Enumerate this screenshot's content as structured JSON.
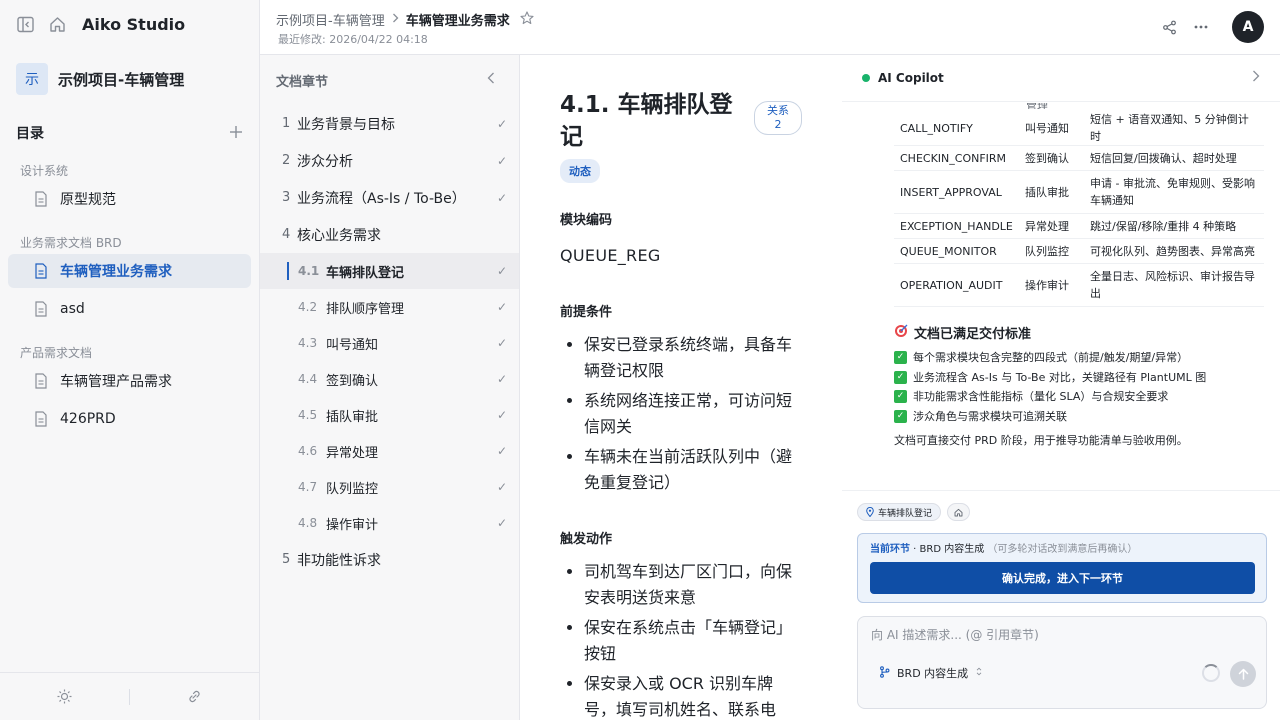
{
  "app": {
    "name": "Aiko Studio",
    "user_initial": "A"
  },
  "project": {
    "badge": "示",
    "name": "示例项目-车辆管理"
  },
  "sidebar": {
    "toc_label": "目录",
    "groups": [
      {
        "label": "设计系统",
        "items": [
          "原型规范"
        ]
      },
      {
        "label": "业务需求文档 BRD",
        "items": [
          "车辆管理业务需求",
          "asd"
        ]
      },
      {
        "label": "产品需求文档",
        "items": [
          "车辆管理产品需求",
          "426PRD"
        ]
      }
    ]
  },
  "topbar": {
    "crumb_project": "示例项目-车辆管理",
    "crumb_doc": "车辆管理业务需求",
    "modified": "最近修改: 2026/04/22 04:18"
  },
  "chapters": {
    "title": "文档章节",
    "items": [
      {
        "num": "1",
        "label": "业务背景与目标"
      },
      {
        "num": "2",
        "label": "涉众分析"
      },
      {
        "num": "3",
        "label": "业务流程（As-Is / To-Be）"
      },
      {
        "num": "4",
        "label": "核心业务需求"
      },
      {
        "num": "4.1",
        "label": "车辆排队登记"
      },
      {
        "num": "4.2",
        "label": "排队顺序管理"
      },
      {
        "num": "4.3",
        "label": "叫号通知"
      },
      {
        "num": "4.4",
        "label": "签到确认"
      },
      {
        "num": "4.5",
        "label": "插队审批"
      },
      {
        "num": "4.6",
        "label": "异常处理"
      },
      {
        "num": "4.7",
        "label": "队列监控"
      },
      {
        "num": "4.8",
        "label": "操作审计"
      },
      {
        "num": "5",
        "label": "非功能性诉求"
      }
    ]
  },
  "content": {
    "title": "4.1. 车辆排队登记",
    "relation_label": "关系",
    "relation_count": "2",
    "tag": "动态",
    "code_heading": "模块编码",
    "code": "QUEUE_REG",
    "pre_heading": "前提条件",
    "pre": [
      "保安已登录系统终端，具备车辆登记权限",
      "系统网络连接正常，可访问短信网关",
      "车辆未在当前活跃队列中（避免重复登记）"
    ],
    "trigger_heading": "触发动作",
    "trigger": [
      "司机驾车到达厂区门口，向保安表明送货来意",
      "保安在系统点击「车辆登记」按钮",
      "保安录入或 OCR 识别车牌号，填写司机姓名、联系电"
    ]
  },
  "copilot": {
    "title": "AI Copilot",
    "cut_text": "管理",
    "modules": [
      {
        "code": "CALL_NOTIFY",
        "name": "叫号通知",
        "desc": "短信 + 语音双通知、5 分钟倒计时"
      },
      {
        "code": "CHECKIN_CONFIRM",
        "name": "签到确认",
        "desc": "短信回复/回拨确认、超时处理"
      },
      {
        "code": "INSERT_APPROVAL",
        "name": "插队审批",
        "desc": "申请 - 审批流、免审规则、受影响车辆通知"
      },
      {
        "code": "EXCEPTION_HANDLE",
        "name": "异常处理",
        "desc": "跳过/保留/移除/重排 4 种策略"
      },
      {
        "code": "QUEUE_MONITOR",
        "name": "队列监控",
        "desc": "可视化队列、趋势图表、异常高亮"
      },
      {
        "code": "OPERATION_AUDIT",
        "name": "操作审计",
        "desc": "全量日志、风险标识、审计报告导出"
      }
    ],
    "std_title": "文档已满足交付标准",
    "checks": [
      "每个需求模块包含完整的四段式（前提/触发/期望/异常）",
      "业务流程含 As-Is 与 To-Be 对比，关键路径有 PlantUML 图",
      "非功能需求含性能指标（量化 SLA）与合规安全要求",
      "涉众角色与需求模块可追溯关联"
    ],
    "note": "文档可直接交付 PRD 阶段，用于推导功能清单与验收用例。",
    "context_chip": "车辆排队登记",
    "stage_lead": "当前环节",
    "stage_sep": " · ",
    "stage_name": "BRD 内容生成",
    "stage_hint": "（可多轮对话改到满意后再确认）",
    "confirm_btn": "确认完成，进入下一环节",
    "input_placeholder": "向 AI 描述需求... (@ 引用章节)",
    "mode_label": "BRD 内容生成"
  }
}
